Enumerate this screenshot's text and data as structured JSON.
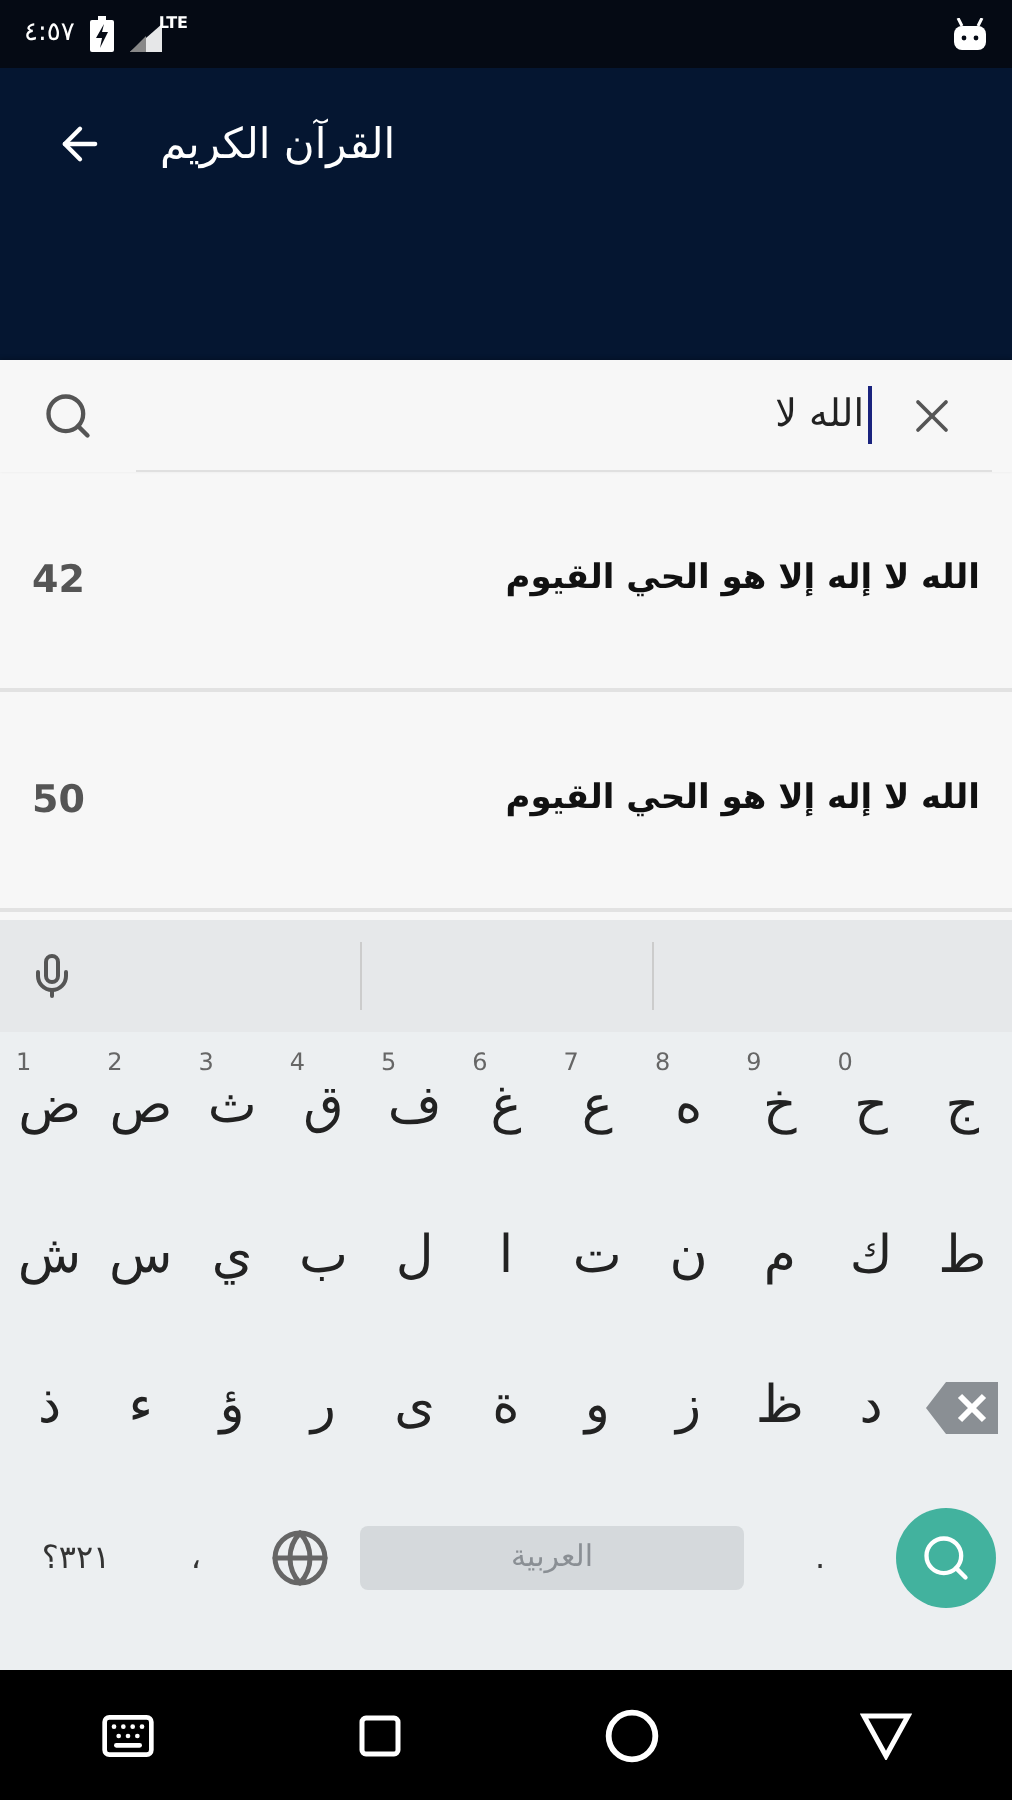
{
  "status_bar": {
    "time": "٤:٥٧",
    "network": "LTE"
  },
  "app_bar": {
    "title": "القرآن الكريم"
  },
  "search": {
    "value": "الله لا"
  },
  "results": [
    {
      "text": "الله لا إله إلا هو الحي القيوم",
      "number": "42"
    },
    {
      "text": "الله لا إله إلا هو الحي القيوم",
      "number": "50"
    }
  ],
  "keyboard": {
    "rows": [
      [
        {
          "label": "ج"
        },
        {
          "label": "ح",
          "hint": "0"
        },
        {
          "label": "خ",
          "hint": "9"
        },
        {
          "label": "ه",
          "hint": "8"
        },
        {
          "label": "ع",
          "hint": "7"
        },
        {
          "label": "غ",
          "hint": "6"
        },
        {
          "label": "ف",
          "hint": "5"
        },
        {
          "label": "ق",
          "hint": "4"
        },
        {
          "label": "ث",
          "hint": "3"
        },
        {
          "label": "ص",
          "hint": "2"
        },
        {
          "label": "ض",
          "hint": "1"
        }
      ],
      [
        {
          "label": "ط"
        },
        {
          "label": "ك"
        },
        {
          "label": "م"
        },
        {
          "label": "ن"
        },
        {
          "label": "ت"
        },
        {
          "label": "ا"
        },
        {
          "label": "ل"
        },
        {
          "label": "ب"
        },
        {
          "label": "ي"
        },
        {
          "label": "س"
        },
        {
          "label": "ش"
        }
      ],
      [
        {
          "kind": "backspace"
        },
        {
          "label": "د"
        },
        {
          "label": "ظ"
        },
        {
          "label": "ز"
        },
        {
          "label": "و"
        },
        {
          "label": "ة"
        },
        {
          "label": "ى"
        },
        {
          "label": "ر"
        },
        {
          "label": "ؤ"
        },
        {
          "label": "ء"
        },
        {
          "label": "ذ"
        }
      ]
    ],
    "bottom_row": [
      {
        "kind": "search"
      },
      {
        "kind": "key",
        "label": "."
      },
      {
        "kind": "space",
        "label": "العربية"
      },
      {
        "kind": "globe"
      },
      {
        "kind": "key",
        "label": "،"
      },
      {
        "kind": "key",
        "label": "٣٢١؟"
      }
    ]
  }
}
